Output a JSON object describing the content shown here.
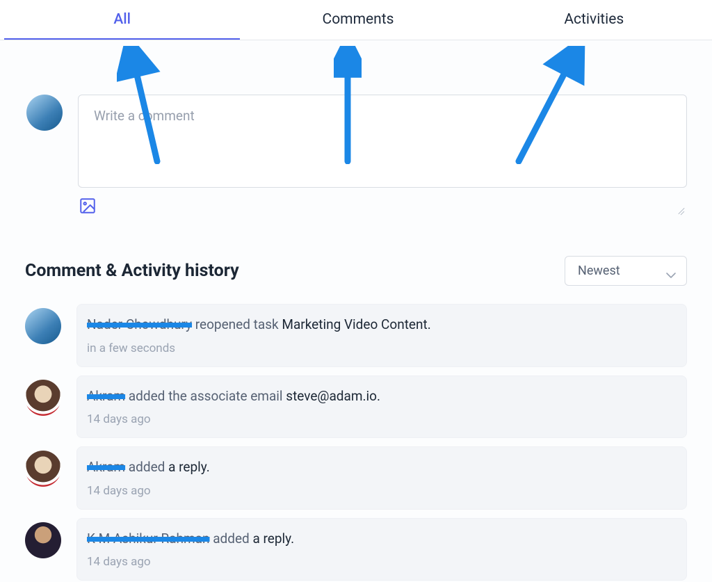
{
  "tabs": {
    "items": [
      {
        "label": "All",
        "active": true
      },
      {
        "label": "Comments",
        "active": false
      },
      {
        "label": "Activities",
        "active": false
      }
    ]
  },
  "composer": {
    "placeholder": "Write a comment"
  },
  "history": {
    "title": "Comment & Activity history",
    "sort_selected": "Newest"
  },
  "feed": [
    {
      "actor": "Nader Chowdhury",
      "action_prefix": " reopened task ",
      "object": "Marketing Video Content.",
      "time": "in a few seconds"
    },
    {
      "actor": "Akram",
      "action_prefix": " added the associate email ",
      "object": "steve@adam.io.",
      "time": "14 days ago"
    },
    {
      "actor": "Akram",
      "action_prefix": " added ",
      "object": "a reply.",
      "time": "14 days ago"
    },
    {
      "actor": "K M Ashikur Rahman",
      "action_prefix": " added ",
      "object": "a reply.",
      "time": "14 days ago"
    }
  ]
}
